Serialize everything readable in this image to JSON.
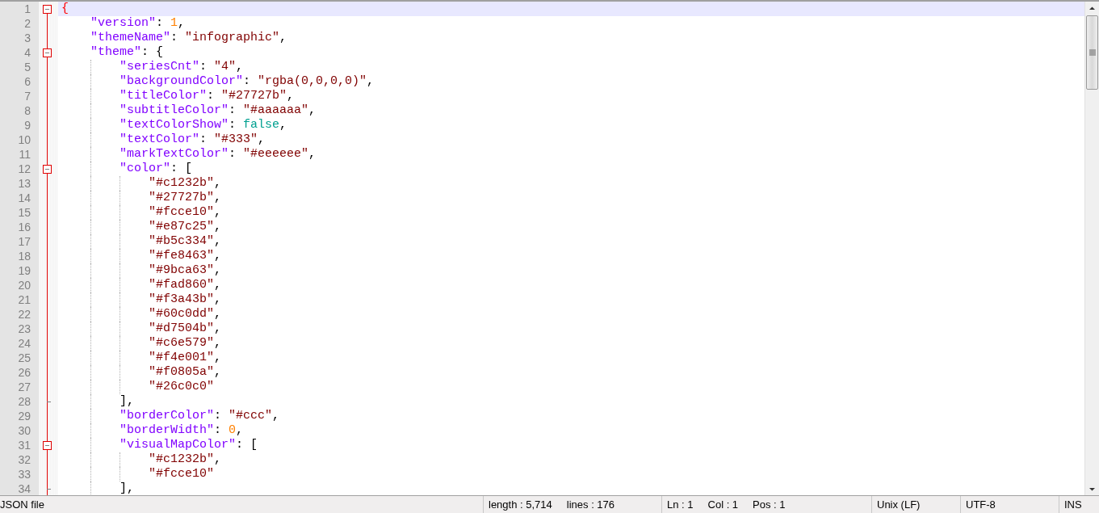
{
  "editor": {
    "lines": [
      {
        "number": "1",
        "current": true,
        "expanded": true,
        "tokens": [
          {
            "kind": "match",
            "text": "{"
          }
        ],
        "children": [
          {
            "number": "2",
            "current": false,
            "tokens": [
              {
                "kind": "key",
                "text": "\"version\""
              },
              {
                "kind": "punct",
                "text": ": "
              },
              {
                "kind": "number",
                "text": "1"
              },
              {
                "kind": "punct",
                "text": ","
              }
            ]
          },
          {
            "number": "3",
            "current": false,
            "tokens": [
              {
                "kind": "key",
                "text": "\"themeName\""
              },
              {
                "kind": "punct",
                "text": ": "
              },
              {
                "kind": "string",
                "text": "\"infographic\""
              },
              {
                "kind": "punct",
                "text": ","
              }
            ]
          },
          {
            "number": "4",
            "current": false,
            "expanded": true,
            "tokens": [
              {
                "kind": "key",
                "text": "\"theme\""
              },
              {
                "kind": "punct",
                "text": ": {"
              }
            ],
            "children": [
              {
                "number": "5",
                "current": false,
                "tokens": [
                  {
                    "kind": "key",
                    "text": "\"seriesCnt\""
                  },
                  {
                    "kind": "punct",
                    "text": ": "
                  },
                  {
                    "kind": "string",
                    "text": "\"4\""
                  },
                  {
                    "kind": "punct",
                    "text": ","
                  }
                ]
              },
              {
                "number": "6",
                "current": false,
                "tokens": [
                  {
                    "kind": "key",
                    "text": "\"backgroundColor\""
                  },
                  {
                    "kind": "punct",
                    "text": ": "
                  },
                  {
                    "kind": "string",
                    "text": "\"rgba(0,0,0,0)\""
                  },
                  {
                    "kind": "punct",
                    "text": ","
                  }
                ]
              },
              {
                "number": "7",
                "current": false,
                "tokens": [
                  {
                    "kind": "key",
                    "text": "\"titleColor\""
                  },
                  {
                    "kind": "punct",
                    "text": ": "
                  },
                  {
                    "kind": "string",
                    "text": "\"#27727b\""
                  },
                  {
                    "kind": "punct",
                    "text": ","
                  }
                ]
              },
              {
                "number": "8",
                "current": false,
                "tokens": [
                  {
                    "kind": "key",
                    "text": "\"subtitleColor\""
                  },
                  {
                    "kind": "punct",
                    "text": ": "
                  },
                  {
                    "kind": "string",
                    "text": "\"#aaaaaa\""
                  },
                  {
                    "kind": "punct",
                    "text": ","
                  }
                ]
              },
              {
                "number": "9",
                "current": false,
                "tokens": [
                  {
                    "kind": "key",
                    "text": "\"textColorShow\""
                  },
                  {
                    "kind": "punct",
                    "text": ": "
                  },
                  {
                    "kind": "bool",
                    "text": "false"
                  },
                  {
                    "kind": "punct",
                    "text": ","
                  }
                ]
              },
              {
                "number": "10",
                "current": false,
                "tokens": [
                  {
                    "kind": "key",
                    "text": "\"textColor\""
                  },
                  {
                    "kind": "punct",
                    "text": ": "
                  },
                  {
                    "kind": "string",
                    "text": "\"#333\""
                  },
                  {
                    "kind": "punct",
                    "text": ","
                  }
                ]
              },
              {
                "number": "11",
                "current": false,
                "tokens": [
                  {
                    "kind": "key",
                    "text": "\"markTextColor\""
                  },
                  {
                    "kind": "punct",
                    "text": ": "
                  },
                  {
                    "kind": "string",
                    "text": "\"#eeeeee\""
                  },
                  {
                    "kind": "punct",
                    "text": ","
                  }
                ]
              },
              {
                "number": "12",
                "current": false,
                "expanded": true,
                "tokens": [
                  {
                    "kind": "key",
                    "text": "\"color\""
                  },
                  {
                    "kind": "punct",
                    "text": ": ["
                  }
                ],
                "children": [
                  {
                    "number": "13",
                    "current": false,
                    "tokens": [
                      {
                        "kind": "string",
                        "text": "\"#c1232b\""
                      },
                      {
                        "kind": "punct",
                        "text": ","
                      }
                    ]
                  },
                  {
                    "number": "14",
                    "current": false,
                    "tokens": [
                      {
                        "kind": "string",
                        "text": "\"#27727b\""
                      },
                      {
                        "kind": "punct",
                        "text": ","
                      }
                    ]
                  },
                  {
                    "number": "15",
                    "current": false,
                    "tokens": [
                      {
                        "kind": "string",
                        "text": "\"#fcce10\""
                      },
                      {
                        "kind": "punct",
                        "text": ","
                      }
                    ]
                  },
                  {
                    "number": "16",
                    "current": false,
                    "tokens": [
                      {
                        "kind": "string",
                        "text": "\"#e87c25\""
                      },
                      {
                        "kind": "punct",
                        "text": ","
                      }
                    ]
                  },
                  {
                    "number": "17",
                    "current": false,
                    "tokens": [
                      {
                        "kind": "string",
                        "text": "\"#b5c334\""
                      },
                      {
                        "kind": "punct",
                        "text": ","
                      }
                    ]
                  },
                  {
                    "number": "18",
                    "current": false,
                    "tokens": [
                      {
                        "kind": "string",
                        "text": "\"#fe8463\""
                      },
                      {
                        "kind": "punct",
                        "text": ","
                      }
                    ]
                  },
                  {
                    "number": "19",
                    "current": false,
                    "tokens": [
                      {
                        "kind": "string",
                        "text": "\"#9bca63\""
                      },
                      {
                        "kind": "punct",
                        "text": ","
                      }
                    ]
                  },
                  {
                    "number": "20",
                    "current": false,
                    "tokens": [
                      {
                        "kind": "string",
                        "text": "\"#fad860\""
                      },
                      {
                        "kind": "punct",
                        "text": ","
                      }
                    ]
                  },
                  {
                    "number": "21",
                    "current": false,
                    "tokens": [
                      {
                        "kind": "string",
                        "text": "\"#f3a43b\""
                      },
                      {
                        "kind": "punct",
                        "text": ","
                      }
                    ]
                  },
                  {
                    "number": "22",
                    "current": false,
                    "tokens": [
                      {
                        "kind": "string",
                        "text": "\"#60c0dd\""
                      },
                      {
                        "kind": "punct",
                        "text": ","
                      }
                    ]
                  },
                  {
                    "number": "23",
                    "current": false,
                    "tokens": [
                      {
                        "kind": "string",
                        "text": "\"#d7504b\""
                      },
                      {
                        "kind": "punct",
                        "text": ","
                      }
                    ]
                  },
                  {
                    "number": "24",
                    "current": false,
                    "tokens": [
                      {
                        "kind": "string",
                        "text": "\"#c6e579\""
                      },
                      {
                        "kind": "punct",
                        "text": ","
                      }
                    ]
                  },
                  {
                    "number": "25",
                    "current": false,
                    "tokens": [
                      {
                        "kind": "string",
                        "text": "\"#f4e001\""
                      },
                      {
                        "kind": "punct",
                        "text": ","
                      }
                    ]
                  },
                  {
                    "number": "26",
                    "current": false,
                    "tokens": [
                      {
                        "kind": "string",
                        "text": "\"#f0805a\""
                      },
                      {
                        "kind": "punct",
                        "text": ","
                      }
                    ]
                  },
                  {
                    "number": "27",
                    "current": false,
                    "tokens": [
                      {
                        "kind": "string",
                        "text": "\"#26c0c0\""
                      }
                    ]
                  }
                ],
                "close": {
                  "number": "28",
                  "current": false,
                  "tokens": [
                    {
                      "kind": "punct",
                      "text": "],"
                    }
                  ]
                }
              },
              {
                "number": "29",
                "current": false,
                "tokens": [
                  {
                    "kind": "key",
                    "text": "\"borderColor\""
                  },
                  {
                    "kind": "punct",
                    "text": ": "
                  },
                  {
                    "kind": "string",
                    "text": "\"#ccc\""
                  },
                  {
                    "kind": "punct",
                    "text": ","
                  }
                ]
              },
              {
                "number": "30",
                "current": false,
                "tokens": [
                  {
                    "kind": "key",
                    "text": "\"borderWidth\""
                  },
                  {
                    "kind": "punct",
                    "text": ": "
                  },
                  {
                    "kind": "number",
                    "text": "0"
                  },
                  {
                    "kind": "punct",
                    "text": ","
                  }
                ]
              },
              {
                "number": "31",
                "current": false,
                "expanded": true,
                "tokens": [
                  {
                    "kind": "key",
                    "text": "\"visualMapColor\""
                  },
                  {
                    "kind": "punct",
                    "text": ": ["
                  }
                ],
                "children": [
                  {
                    "number": "32",
                    "current": false,
                    "tokens": [
                      {
                        "kind": "string",
                        "text": "\"#c1232b\""
                      },
                      {
                        "kind": "punct",
                        "text": ","
                      }
                    ]
                  },
                  {
                    "number": "33",
                    "current": false,
                    "tokens": [
                      {
                        "kind": "string",
                        "text": "\"#fcce10\""
                      }
                    ]
                  }
                ],
                "close": {
                  "number": "34",
                  "current": false,
                  "tokens": [
                    {
                      "kind": "punct",
                      "text": "],"
                    }
                  ]
                }
              }
            ]
          }
        ]
      }
    ]
  },
  "status_bar": {
    "segments": [
      {
        "items": [
          "JSON file"
        ]
      },
      {
        "items": [
          "length : 5,714",
          "lines : 176"
        ]
      },
      {
        "items": [
          "Ln : 1",
          "Col : 1",
          "Pos : 1"
        ]
      },
      {
        "items": [
          "Unix (LF)"
        ]
      },
      {
        "items": [
          "UTF-8"
        ]
      },
      {
        "items": [
          "INS"
        ]
      }
    ]
  }
}
